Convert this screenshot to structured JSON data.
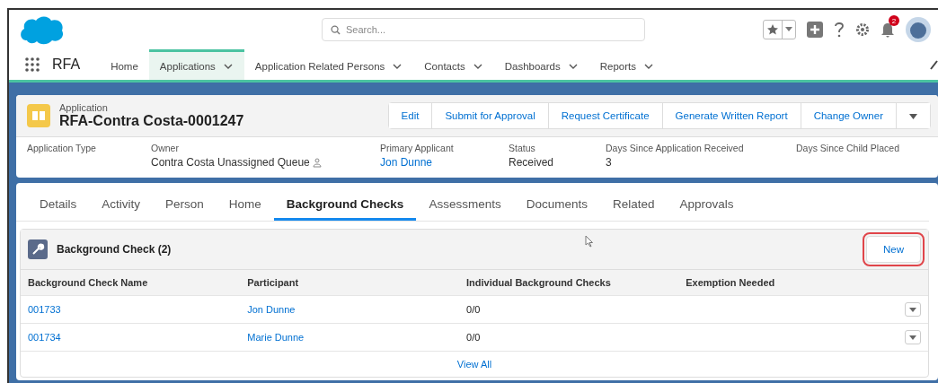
{
  "header": {
    "search": {
      "placeholder": "Search..."
    },
    "notifications": "2"
  },
  "nav": {
    "app_name": "RFA",
    "items": [
      {
        "label": "Home",
        "selected": false,
        "dropdown": false
      },
      {
        "label": "Applications",
        "selected": true,
        "dropdown": true
      },
      {
        "label": "Application Related Persons",
        "selected": false,
        "dropdown": true
      },
      {
        "label": "Contacts",
        "selected": false,
        "dropdown": true
      },
      {
        "label": "Dashboards",
        "selected": false,
        "dropdown": true
      },
      {
        "label": "Reports",
        "selected": false,
        "dropdown": true
      }
    ]
  },
  "record": {
    "object_type": "Application",
    "title": "RFA-Contra Costa-0001247",
    "actions": [
      "Edit",
      "Submit for Approval",
      "Request Certificate",
      "Generate Written Report",
      "Change Owner"
    ],
    "fields": [
      {
        "label": "Application Type"
      },
      {
        "label": "Owner",
        "value": "Contra Costa Unassigned Queue",
        "kind": "owner"
      },
      {
        "label": "Primary Applicant",
        "value": "Jon Dunne",
        "kind": "link"
      },
      {
        "label": "Status",
        "value": "Received",
        "kind": "text"
      },
      {
        "label": "Days Since Application Received",
        "value": "3",
        "kind": "text"
      },
      {
        "label": "Days Since Child Placed"
      }
    ]
  },
  "tabs": [
    {
      "label": "Details",
      "selected": false
    },
    {
      "label": "Activity",
      "selected": false
    },
    {
      "label": "Person",
      "selected": false
    },
    {
      "label": "Home",
      "selected": false
    },
    {
      "label": "Background Checks",
      "selected": true
    },
    {
      "label": "Assessments",
      "selected": false
    },
    {
      "label": "Documents",
      "selected": false
    },
    {
      "label": "Related",
      "selected": false
    },
    {
      "label": "Approvals",
      "selected": false
    }
  ],
  "related_list": {
    "title": "Background Check (2)",
    "new_button": {
      "label": "New",
      "highlighted": true
    },
    "columns": [
      "Background Check Name",
      "Participant",
      "Individual Background Checks",
      "Exemption Needed"
    ],
    "rows": [
      {
        "name": "001733",
        "participant": "Jon Dunne",
        "individual_checks": "0/0"
      },
      {
        "name": "001734",
        "participant": "Marie Dunne",
        "individual_checks": "0/0"
      }
    ],
    "view_all": "View All"
  }
}
